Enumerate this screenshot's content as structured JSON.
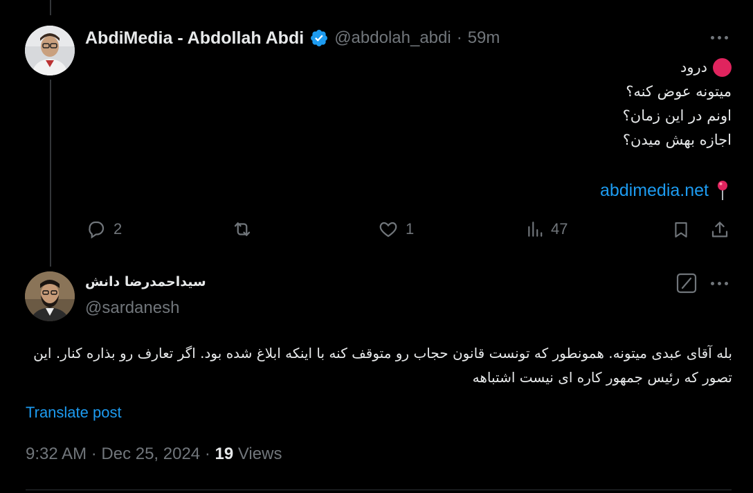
{
  "parent_tweet": {
    "author_name": "AbdiMedia - Abdollah Abdi",
    "handle": "@abdolah_abdi",
    "separator": "·",
    "time_ago": "59m",
    "lines": [
      "درود",
      "میتونه عوض کنه؟",
      "اونم در این زمان؟",
      "اجازه بهش میدن؟"
    ],
    "link_text": "abdimedia.net",
    "stats": {
      "replies": "2",
      "likes": "1",
      "views": "47"
    },
    "colors": {
      "verified": "#1d9bf0",
      "red_dot": "#e0245e"
    }
  },
  "reply_tweet": {
    "author_name": "سیداحمدرضا دانش",
    "handle": "@sardanesh",
    "body": "بله آقای عبدی میتونه. همونطور که تونست قانون حجاب رو متوقف کنه با اینکه ابلاغ شده بود. اگر تعارف رو بذاره کنار. این تصور که رئیس جمهور کاره ای نیست اشتباهه",
    "translate_label": "Translate post",
    "timestamp": "9:32 AM · Dec 25, 2024 ·",
    "views_count": "19",
    "views_label": "Views"
  },
  "icons": [
    "user-avatar",
    "verified-badge-icon",
    "more-icon",
    "red-circle-emoji",
    "pin-emoji",
    "reply-icon",
    "retweet-icon",
    "like-icon",
    "views-icon",
    "bookmark-icon",
    "share-icon",
    "grok-icon"
  ]
}
